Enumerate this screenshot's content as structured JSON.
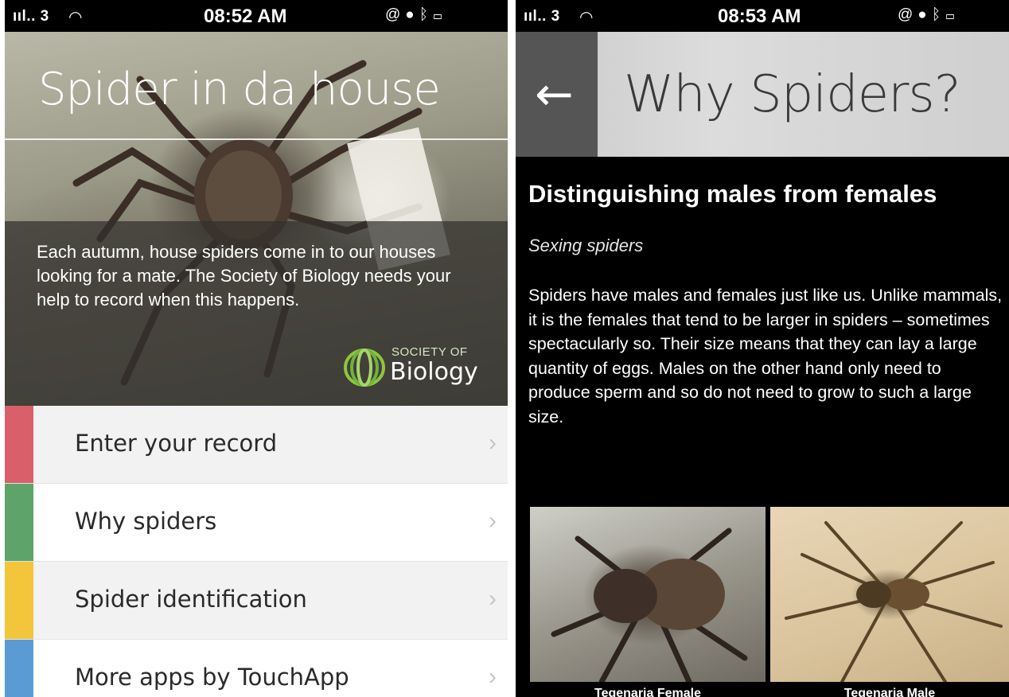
{
  "left_screen": {
    "status": {
      "signal": "ııl.. 3",
      "time": "08:52 AM"
    },
    "title": "Spider in da house",
    "intro": "Each autumn, house spiders come in to our houses looking for a mate. The Society of Biology needs your help to record when this happens.",
    "logo": {
      "line1": "SOCIETY OF",
      "line2": "Biology"
    },
    "menu": [
      {
        "label": "Enter your record",
        "color": "#d9606a"
      },
      {
        "label": "Why spiders",
        "color": "#5da36a"
      },
      {
        "label": "Spider identification",
        "color": "#f2c53a"
      },
      {
        "label": "More apps by TouchApp",
        "color": "#5b9bd5"
      }
    ],
    "chevron": "›"
  },
  "right_screen": {
    "status": {
      "signal": "ııl.. 3",
      "time": "08:53 AM"
    },
    "back_arrow": "←",
    "title": "Why Spiders?",
    "heading": "Distinguishing males from females",
    "subheading": "Sexing spiders",
    "body": "Spiders have males and females just like us. Unlike mammals, it is the females that tend to be larger in spiders – sometimes spectacularly so. Their size means that they can lay a large quantity of eggs. Males on the other hand only need to produce sperm and so do not need to grow to such a large size.",
    "captions": [
      "Tegenaria Female",
      "Tegenaria Male"
    ]
  },
  "icons": [
    "wifi-icon",
    "lock-rotation-icon",
    "location-icon",
    "bluetooth-icon",
    "battery-icon",
    "back-arrow-icon",
    "chevron-right-icon"
  ]
}
